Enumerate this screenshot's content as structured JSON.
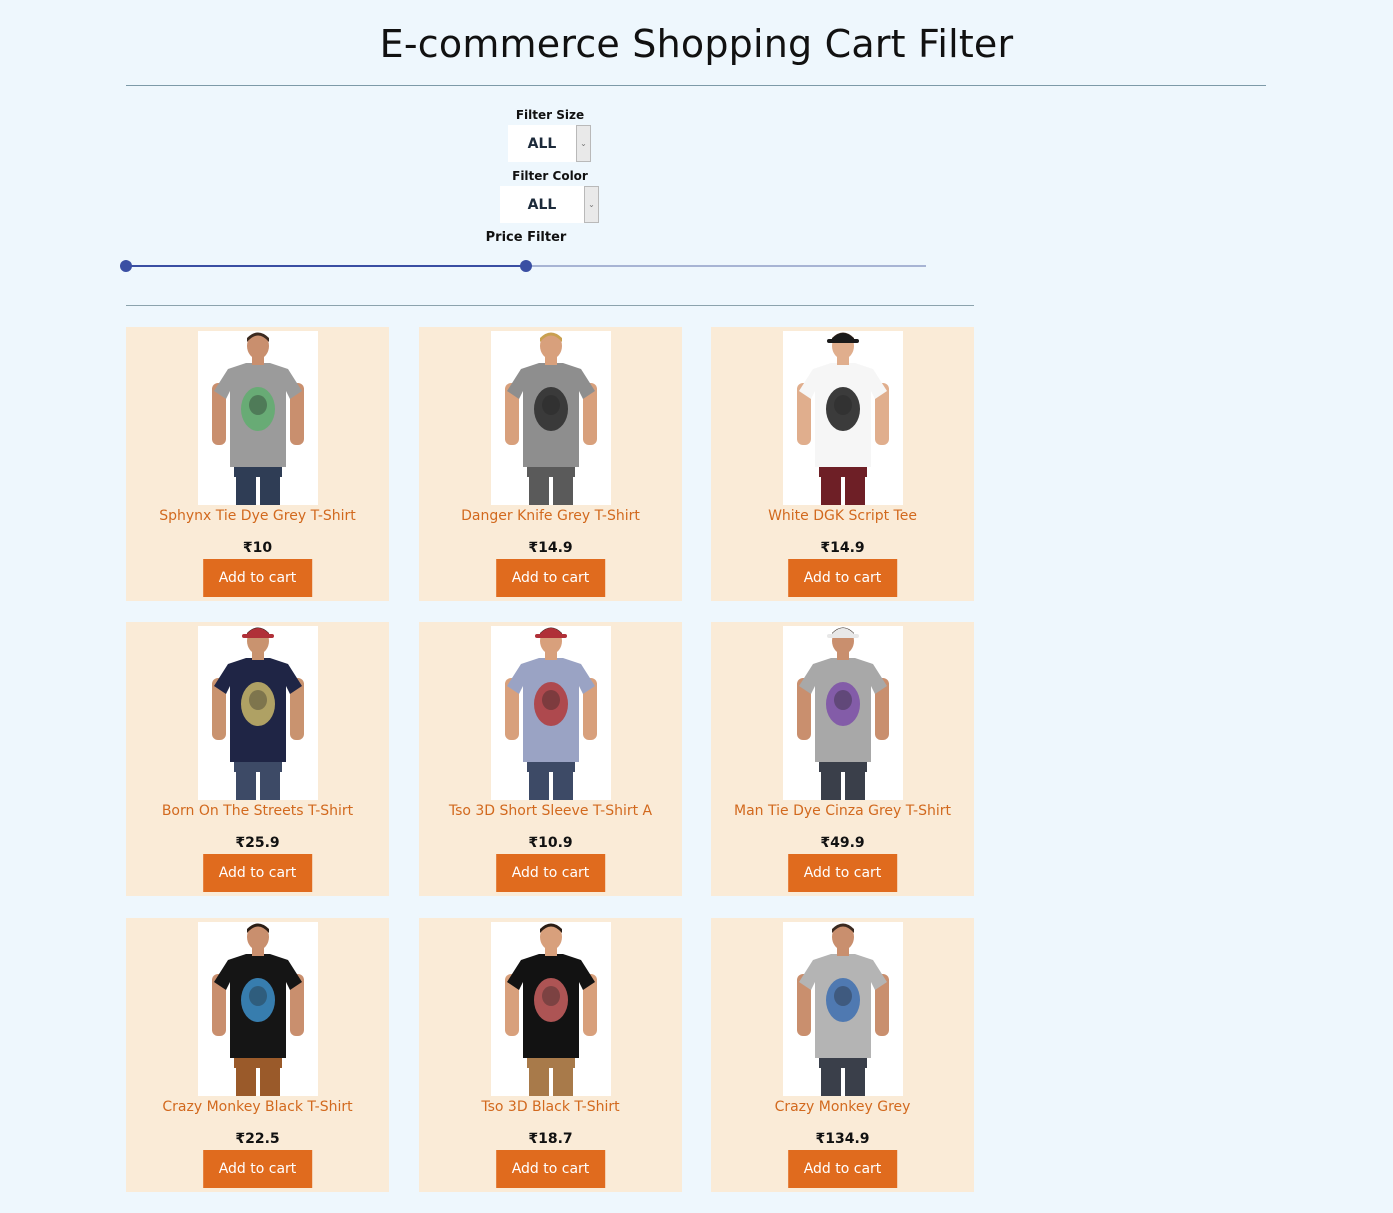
{
  "title": "E-commerce Shopping Cart Filter",
  "filters": {
    "size": {
      "label": "Filter Size",
      "value": "ALL"
    },
    "color": {
      "label": "Filter Color",
      "value": "ALL"
    },
    "price": {
      "label": "Price Filter",
      "range_start_fraction": 0.0,
      "range_end_fraction": 0.5
    }
  },
  "add_to_cart_label": "Add to cart",
  "products": [
    {
      "name": "Sphynx Tie Dye Grey T-Shirt",
      "price": "₹10",
      "shirt_color": "#9b9b9b",
      "print_color": "#5fae6e",
      "pants_color": "#2f3d55",
      "skin": "#c98f6e",
      "hair": "#3b2a20",
      "hat": ""
    },
    {
      "name": "Danger Knife Grey T-Shirt",
      "price": "₹14.9",
      "shirt_color": "#8e8e8e",
      "print_color": "#2c2c2c",
      "pants_color": "#5a5a5a",
      "skin": "#d8a07c",
      "hair": "#c9a050",
      "hat": ""
    },
    {
      "name": "White DGK Script Tee",
      "price": "₹14.9",
      "shirt_color": "#f6f6f6",
      "print_color": "#1a1a1a",
      "pants_color": "#6e1f26",
      "skin": "#e0ae8d",
      "hair": "#4a3020",
      "hat": "#1a1a1a"
    },
    {
      "name": "Born On The Streets T-Shirt",
      "price": "₹25.9",
      "shirt_color": "#1f2545",
      "print_color": "#c9b76a",
      "pants_color": "#3d4a66",
      "skin": "#c9936f",
      "hair": "#2a1d15",
      "hat": "#b03038"
    },
    {
      "name": "Tso 3D Short Sleeve T-Shirt A",
      "price": "₹10.9",
      "shirt_color": "#9aa3c4",
      "print_color": "#b23a3a",
      "pants_color": "#3d4a66",
      "skin": "#d8a07c",
      "hair": "#3b2a20",
      "hat": "#b03038"
    },
    {
      "name": "Man Tie Dye Cinza Grey T-Shirt",
      "price": "₹49.9",
      "shirt_color": "#a8a8a8",
      "print_color": "#7d4fa8",
      "pants_color": "#3a3f4a",
      "skin": "#c98f6e",
      "hair": "#2a1d15",
      "hat": "#e8e8e8"
    },
    {
      "name": "Crazy Monkey Black T-Shirt",
      "price": "₹22.5",
      "shirt_color": "#151515",
      "print_color": "#3d8fc9",
      "pants_color": "#9a5a2a",
      "skin": "#c98f6e",
      "hair": "#2a1d15",
      "hat": ""
    },
    {
      "name": "Tso 3D Black T-Shirt",
      "price": "₹18.7",
      "shirt_color": "#121212",
      "print_color": "#c96060",
      "pants_color": "#a87a4a",
      "skin": "#d8a07c",
      "hair": "#2a1d15",
      "hat": ""
    },
    {
      "name": "Crazy Monkey Grey",
      "price": "₹134.9",
      "shirt_color": "#b4b4b4",
      "print_color": "#3d6fb0",
      "pants_color": "#3a3f4a",
      "skin": "#c98f6e",
      "hair": "#3b2a20",
      "hat": ""
    }
  ]
}
